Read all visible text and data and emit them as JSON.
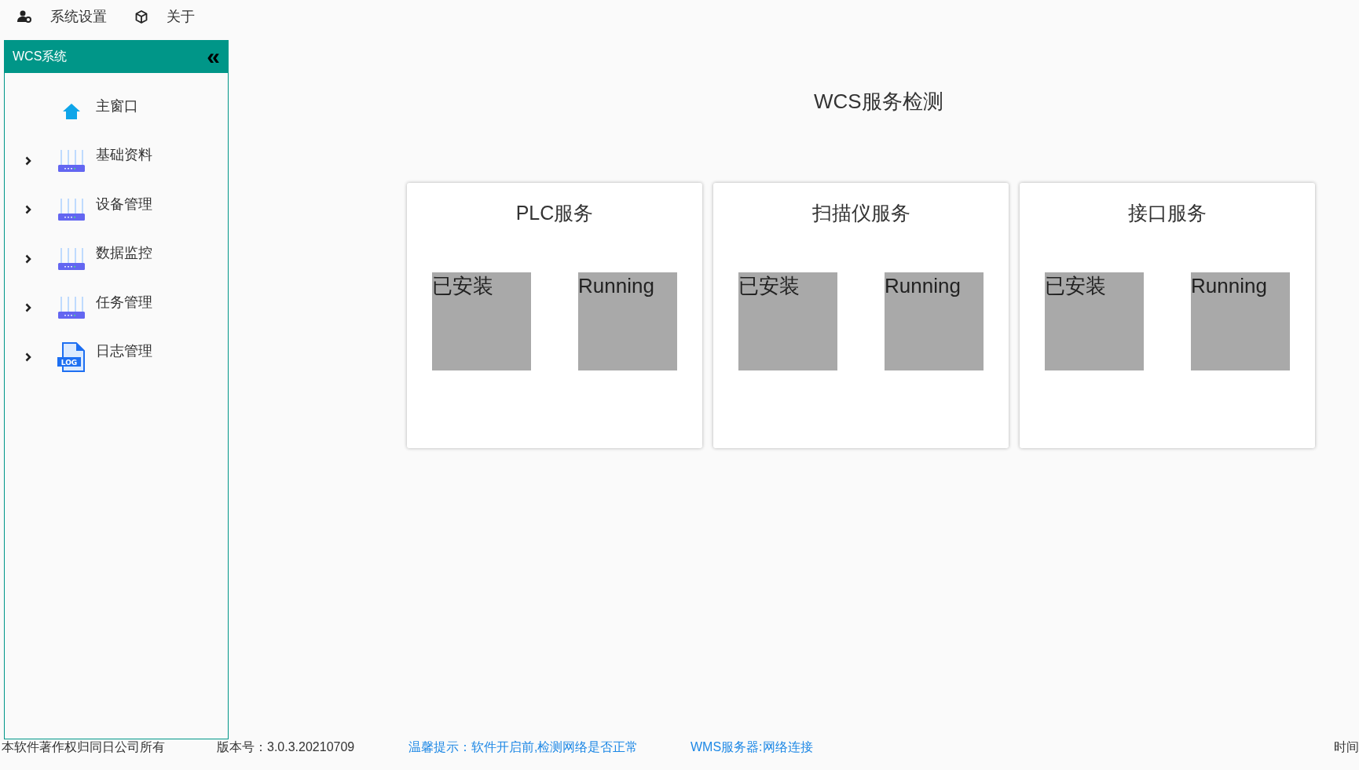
{
  "menu_bar": [
    {
      "label": "系统设置"
    },
    {
      "label": "关于"
    }
  ],
  "sidebar": {
    "title": "WCS系统",
    "collapse_glyph": "«",
    "items": [
      {
        "label": "主窗口",
        "kind": "home",
        "expandable": false
      },
      {
        "label": "基础资料",
        "kind": "router",
        "expandable": true
      },
      {
        "label": "设备管理",
        "kind": "router",
        "expandable": true
      },
      {
        "label": "数据监控",
        "kind": "router",
        "expandable": true
      },
      {
        "label": "任务管理",
        "kind": "router",
        "expandable": true
      },
      {
        "label": "日志管理",
        "kind": "log",
        "icon_text": "LOG",
        "expandable": true
      }
    ]
  },
  "main": {
    "title": "WCS服务检测",
    "services": [
      {
        "name": "PLC服务",
        "install_status": "已安装",
        "run_status": "Running"
      },
      {
        "name": "扫描仪服务",
        "install_status": "已安装",
        "run_status": "Running"
      },
      {
        "name": "接口服务",
        "install_status": "已安装",
        "run_status": "Running"
      }
    ]
  },
  "status_bar": {
    "copyright": "本软件著作权归同日公司所有",
    "version": "版本号：3.0.3.20210709",
    "tip": "温馨提示：软件开启前,检测网络是否正常",
    "wms": "WMS服务器:网络连接",
    "time": "时间"
  }
}
